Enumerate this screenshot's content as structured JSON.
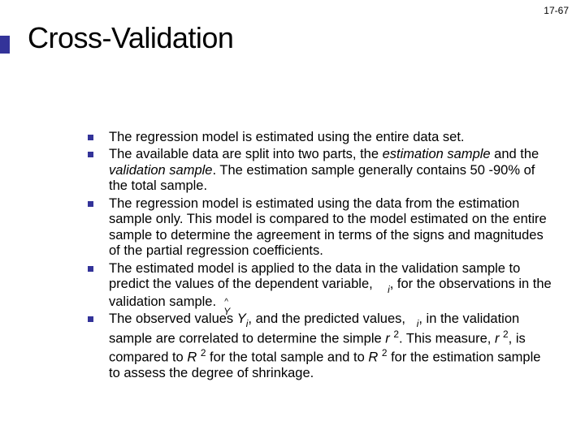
{
  "page_number": "17-67",
  "title": "Cross-Validation",
  "bullets": [
    {
      "html": "The regression model is estimated using the entire data set."
    },
    {
      "html": "The available data are split into two parts, the <span class=\"ital\">estimation sample</span> and the <span class=\"ital\">validation sample</span>.  The estimation sample generally contains 50 -90% of the total sample."
    },
    {
      "html": "The regression model is estimated using the data from the estimation sample only.  This model is compared to the model estimated on the entire sample to determine the agreement in terms of the signs and magnitudes of the partial regression coefficients."
    },
    {
      "html": "The estimated model is applied to the data in the validation sample to predict the values of the dependent variable, &nbsp;&nbsp;&nbsp;<span class=\"ital sub\">i</span>, for the observations in the validation sample.&nbsp;&nbsp;<span class=\"y-hat\"><span class=\"hat\">^</span><span class=\"ital\" style=\"font-size:12px;position:absolute;top:0;left:0;\">Y</span></span>"
    },
    {
      "html": "The observed values <span class=\"ital\">Y<span class=\"sub\">i</span></span>, and the predicted values, &nbsp;&nbsp;<span class=\"ital sub\">i</span>, in the validation sample are correlated to determine the simple <span class=\"ital\">r</span> <span class=\"sup\">2</span>.  This measure, <span class=\"ital\">r</span> <span class=\"sup\">2</span>, is compared to <span class=\"ital\">R</span> <span class=\"sup\">2</span> for the total sample and to <span class=\"ital\">R</span> <span class=\"sup\">2</span> for the estimation sample to assess the degree of shrinkage."
    }
  ]
}
